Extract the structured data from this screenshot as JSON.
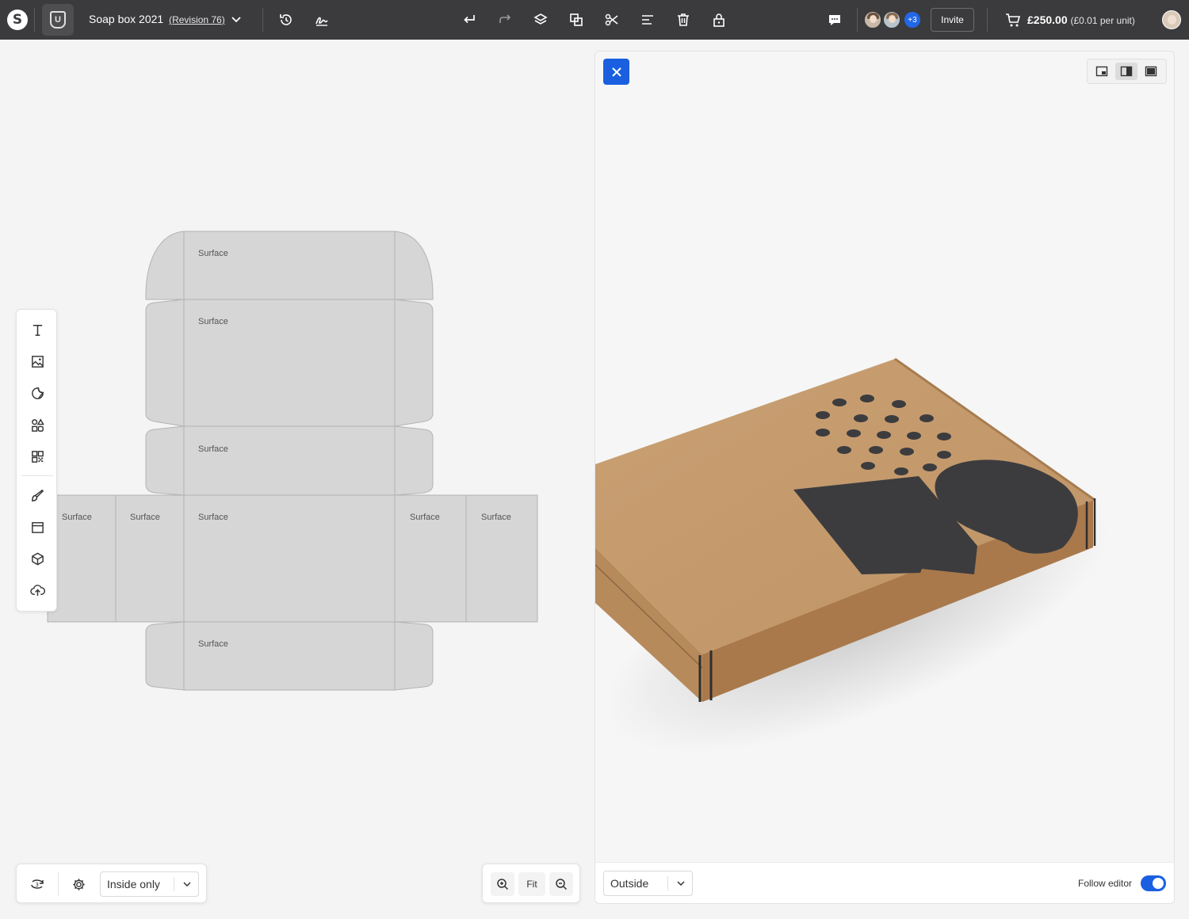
{
  "header": {
    "logo_letter": "S",
    "brand_mark": "U",
    "doc_title": "Soap box 2021",
    "revision": "(Revision 76)",
    "collaborators_more": "+3",
    "invite_label": "Invite",
    "price": "£250.00",
    "price_unit": "(£0.01 per unit)",
    "icons": [
      "history-icon",
      "signature-icon",
      "undo-icon",
      "redo-icon",
      "layers-icon",
      "duplicate-icon",
      "scissors-icon",
      "align-icon",
      "delete-icon",
      "lock-icon",
      "comment-icon",
      "cart-icon"
    ]
  },
  "dieline": {
    "panel_label": "Surface",
    "fill_color": "#d6d6d6",
    "stroke_color": "#b5b5b5"
  },
  "toolbar_left": {
    "tools": [
      "text-icon",
      "image-icon",
      "sticker-icon",
      "shapes-icon",
      "qr-code-icon",
      "brush-icon",
      "template-icon",
      "box-3d-icon",
      "upload-icon"
    ]
  },
  "bottom_left": {
    "view_select": "Inside only"
  },
  "zoom": {
    "fit_label": "Fit"
  },
  "viewer": {
    "side_select": "Outside",
    "follow_editor_label": "Follow editor",
    "follow_editor_on": true,
    "box_color": "#c49a6c",
    "print_color": "#3c3c3f",
    "accent": "#1a5fe0"
  }
}
